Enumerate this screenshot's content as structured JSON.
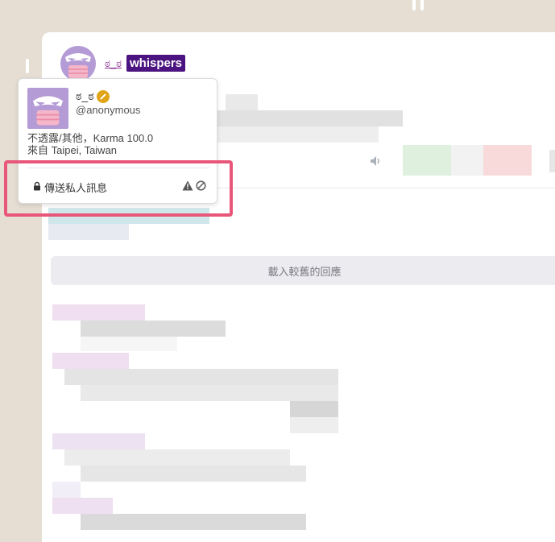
{
  "post": {
    "author_name": "ಠ_ಠ",
    "tag_label": "whispers"
  },
  "load_more_label": "載入較舊的回應",
  "profile_popup": {
    "name": "ಠ_ಠ",
    "handle": "@anonymous",
    "info_line1": "不透露/其他，Karma 100.0",
    "info_line2": "來自 Taipei, Taiwan",
    "send_message_label": "傳送私人訊息"
  },
  "colors": {
    "accent_purple": "#4b1480",
    "link_purple": "#8a2b8f",
    "highlight": "#e8577a",
    "badge": "#e0a417"
  }
}
